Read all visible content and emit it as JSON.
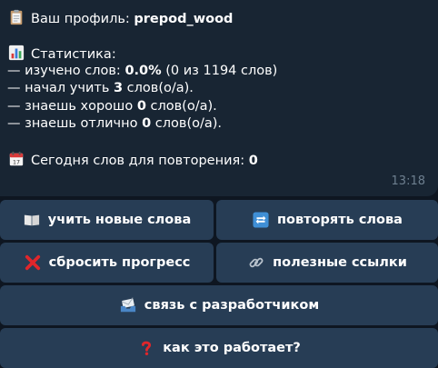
{
  "profile": {
    "label": "Ваш профиль: ",
    "username": "prepod_wood"
  },
  "stats": {
    "title": "Статистика:",
    "learned_prefix": "— изучено слов: ",
    "learned_value": "0.0%",
    "learned_suffix": " (0 из 1194 слов)",
    "started_prefix": "— начал учить ",
    "started_value": "3",
    "started_suffix": " слов(о/а).",
    "good_prefix": "— знаешь хорошо ",
    "good_value": "0",
    "good_suffix": " слов(о/а).",
    "excellent_prefix": "— знаешь отлично ",
    "excellent_value": "0",
    "excellent_suffix": " слов(о/а)."
  },
  "today": {
    "label": "Сегодня слов для повторения: ",
    "value": "0"
  },
  "message": {
    "time": "13:18"
  },
  "buttons": {
    "learn_new": "учить новые слова",
    "repeat": "повторять слова",
    "reset": "сбросить прогресс",
    "links": "полезные ссылки",
    "contact": "связь с разработчиком",
    "how": "как это работает?"
  },
  "icons": {
    "profile": "clipboard-icon",
    "stats": "bar-chart-icon",
    "calendar": "calendar-icon",
    "learn_new": "open-book-icon",
    "repeat": "repeat-icon",
    "reset": "red-cross-icon",
    "links": "link-icon",
    "contact": "envelope-tray-icon",
    "how": "question-mark-icon"
  }
}
